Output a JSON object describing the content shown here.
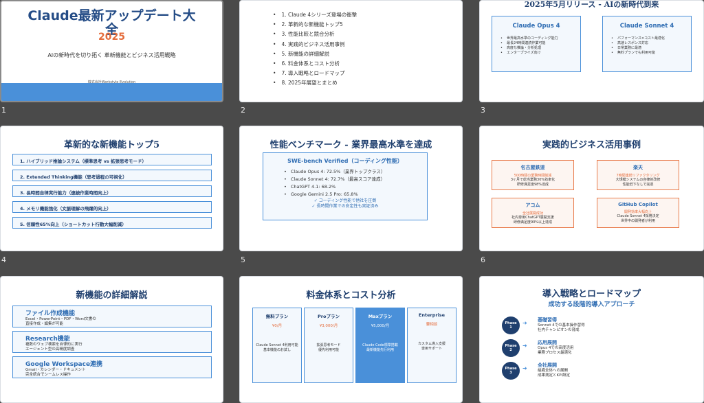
{
  "slides": [
    {
      "num": "1",
      "title_line1": "Claude最新アップデート大",
      "title_line2": "全",
      "year": "2025",
      "subtitle": "AIの新時代を切り拓く 革新機能とビジネス活用戦略",
      "company": "株式会社Workstyle Evolution"
    },
    {
      "num": "2",
      "items": [
        "1. Claude 4シリーズ登場の衝撃",
        "2. 革新的な新機能トップ5",
        "3. 性能比較と競合分析",
        "4. 実践的ビジネス活用事例",
        "5. 新機能の詳細解説",
        "6. 料金体系とコスト分析",
        "7. 導入戦略とロードマップ",
        "8. 2025年展望とまとめ"
      ]
    },
    {
      "num": "3",
      "title": "2025年5月リリース - AIの新時代到来",
      "cards": [
        {
          "name": "Claude Opus 4",
          "items": [
            "世界最高水準のコーディング能力",
            "最長24時間連続作業可能",
            "高度な推論・分析処理",
            "エンタープライズ向け"
          ]
        },
        {
          "name": "Claude Sonnet 4",
          "items": [
            "パフォーマンス×コスト最適化",
            "高速レスポンス対応",
            "日常業務に最適",
            "無料プランでも利用可能"
          ]
        }
      ]
    },
    {
      "num": "4",
      "title": "革新的な新機能トップ5",
      "features": [
        "1. ハイブリッド推論システム（標準思考 vs 拡張思考モード）",
        "2. Extended Thinking機能（思考過程の可視化）",
        "3. 長時間自律実行能力（連続作業時間向上）",
        "4. メモリ機能強化（文脈理解の飛躍的向上）",
        "5. 信頼性65%向上（ショートカット行動大幅削減）"
      ]
    },
    {
      "num": "5",
      "title": "性能ベンチマーク - 業界最高水準を達成",
      "bench_title": "SWE-bench Verified（コーディング性能）",
      "scores": [
        "Claude Opus 4: 72.5%（業界トップクラス）",
        "Claude Sonnet 4: 72.7%（最高スコア達成）",
        "ChatGPT 4.1: 68.2%",
        "Google Gemini 2.5 Pro: 65.8%"
      ],
      "notes": [
        "✓ コーディング性能で他社を圧倒",
        "✓ 長時間作業での安定性も実証済み"
      ]
    },
    {
      "num": "6",
      "title": "実践的ビジネス活用事例",
      "cases": [
        {
          "name": "名古屋鉄道",
          "highlight": "500時間の業務時間削減",
          "lines": [
            "3ヶ月で総当業務30%効率化",
            "研修満足度98%達成"
          ]
        },
        {
          "name": "楽天",
          "highlight": "7時間連続リファクタリング",
          "lines": [
            "大規模システムの自律的改修",
            "性能低下なしで完遂"
          ]
        },
        {
          "name": "アコム",
          "highlight": "全社展開成功",
          "lines": [
            "社内専用ChatGPT展開支援",
            "研修満足度90%以上達成"
          ]
        },
        {
          "name": "GitHub Copilot",
          "highlight": "開発効率大幅向上",
          "lines": [
            "Claude Sonnet 4採用決定",
            "世界中の開発者が利用"
          ]
        }
      ]
    },
    {
      "num": "7",
      "title": "新機能の詳細解説",
      "features": [
        {
          "name": "ファイル作成機能",
          "lines": [
            "Excel・PowerPoint・PDF・Word文書の",
            "直接作成・編集が可能"
          ]
        },
        {
          "name": "Research機能",
          "lines": [
            "複数のウェブ検索を自律的に実行",
            "エージェント型の高精度調査"
          ]
        },
        {
          "name": "Google Workspace連携",
          "lines": [
            "Gmail・カレンダー・ドキュメント",
            "完全統合でシームレス操作"
          ]
        }
      ]
    },
    {
      "num": "8",
      "title": "料金体系とコスト分析",
      "plans": [
        {
          "name": "無料プラン",
          "price": "¥0/月",
          "lines": [
            "Claude Sonnet 4利用可能",
            "基本機能のお試し"
          ]
        },
        {
          "name": "Proプラン",
          "price": "¥3,000/月",
          "lines": [
            "拡張思考モード",
            "優先利用可能"
          ]
        },
        {
          "name": "Maxプラン",
          "price": "¥5,000/月",
          "lines": [
            "Claude Code標準搭載",
            "最新機能先行利用"
          ]
        },
        {
          "name": "Enterprise",
          "price": "要相談",
          "lines": [
            "カスタム導入支援",
            "専用サポート"
          ]
        }
      ]
    },
    {
      "num": "9",
      "title": "導入戦略とロードマップ",
      "subtitle": "成功する段階的導入アプローチ",
      "phases": [
        {
          "badge1": "Phase",
          "badge2": "1",
          "name": "基礎習得",
          "lines": [
            "Sonnet 4での基本操作習得",
            "社内チャンピオンの育成"
          ]
        },
        {
          "badge1": "Phase",
          "badge2": "2",
          "name": "応用展開",
          "lines": [
            "Opus 4での高度活用",
            "業務プロセス最適化"
          ]
        },
        {
          "badge1": "Phase",
          "badge2": "3",
          "name": "全社展開",
          "lines": [
            "組織全体への展開",
            "成果測定とKPI設定"
          ]
        }
      ]
    }
  ],
  "icons": {
    "arrow": "➜"
  },
  "colors": {
    "background": "#4a4a4a",
    "accent": "#4a90d9",
    "navy": "#1f3f6e",
    "orange": "#e46b3a"
  }
}
